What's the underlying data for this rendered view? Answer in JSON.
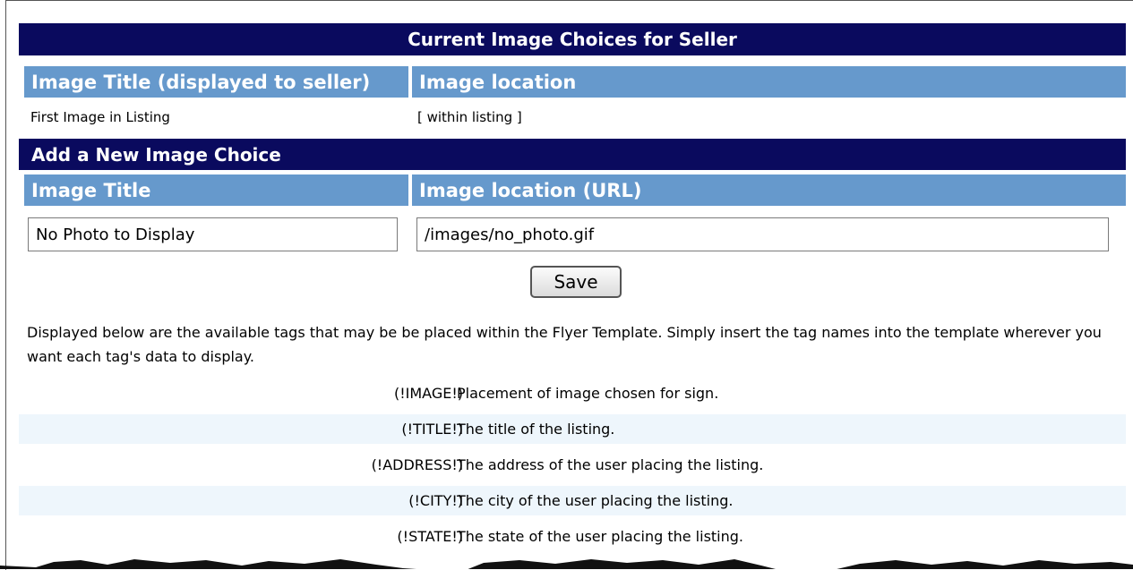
{
  "current_section": {
    "title": "Current Image Choices for Seller",
    "col_title": "Image Title (displayed to seller)",
    "col_location": "Image location",
    "rows": [
      {
        "title": "First Image in Listing",
        "location": "[ within listing ]"
      }
    ]
  },
  "add_section": {
    "title": "Add a New Image Choice",
    "col_title": "Image Title",
    "col_location": "Image location (URL)",
    "title_value": "No Photo to Display",
    "location_value": "/images/no_photo.gif",
    "save_label": "Save"
  },
  "tags_description": "Displayed below are the available tags that may be be placed within the Flyer Template. Simply insert the tag names into the template wherever you want each tag's data to display.",
  "tags": [
    {
      "tag": "(!IMAGE!)",
      "desc": "Placement of image chosen for sign."
    },
    {
      "tag": "(!TITLE!)",
      "desc": "The title of the listing."
    },
    {
      "tag": "(!ADDRESS!)",
      "desc": "The address of the user placing the listing."
    },
    {
      "tag": "(!CITY!)",
      "desc": "The city of the user placing the listing."
    },
    {
      "tag": "(!STATE!)",
      "desc": "The state of the user placing the listing."
    }
  ]
}
